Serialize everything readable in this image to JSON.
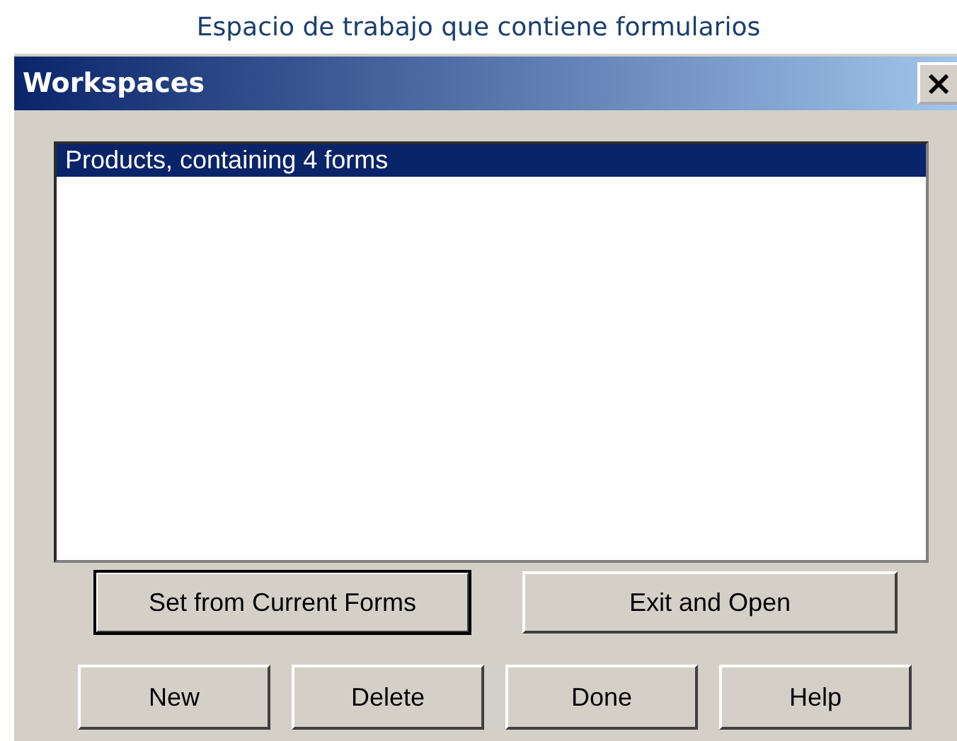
{
  "caption": "Espacio de trabajo que contiene formularios",
  "window": {
    "title": "Workspaces",
    "close": "×"
  },
  "list": {
    "items": [
      {
        "label": "Products, containing 4 forms",
        "selected": true
      }
    ]
  },
  "button_rows": [
    {
      "buttons": [
        {
          "label": "Set from Current Forms",
          "default": true
        },
        {
          "label": "Exit and Open",
          "default": false
        }
      ]
    },
    {
      "buttons": [
        {
          "label": "New",
          "default": false
        },
        {
          "label": "Delete",
          "default": false
        },
        {
          "label": "Done",
          "default": false
        },
        {
          "label": "Help",
          "default": false
        }
      ]
    }
  ]
}
